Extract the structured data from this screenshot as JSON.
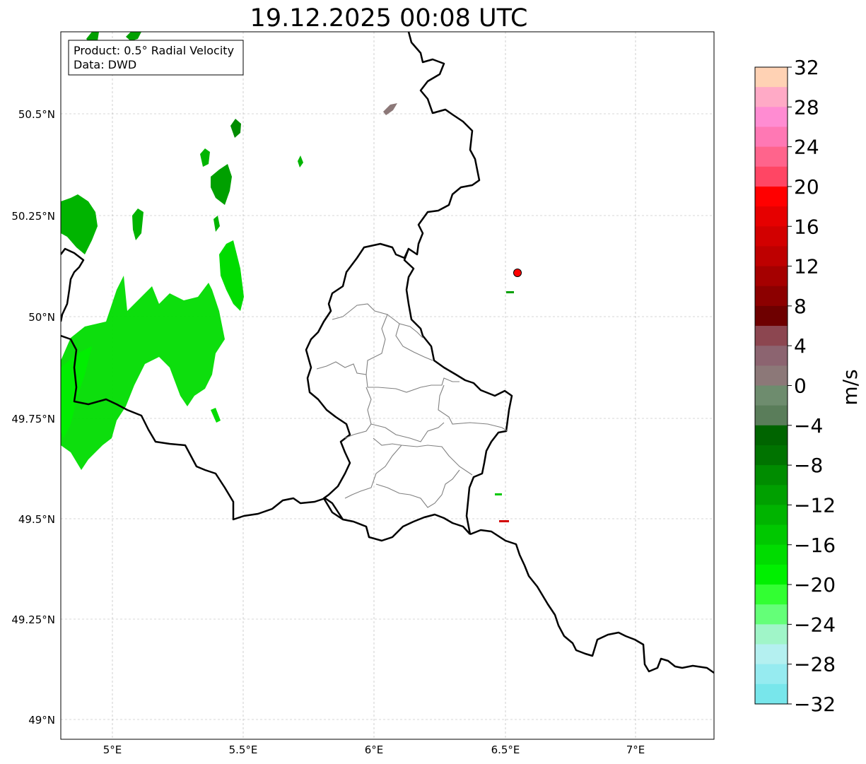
{
  "title": "19.12.2025 00:08 UTC",
  "info_box": {
    "product_line": "Product: 0.5° Radial Velocity",
    "data_line": "Data: DWD"
  },
  "axes": {
    "lon_ticks": [
      "5°E",
      "5.5°E",
      "6°E",
      "6.5°E",
      "7°E"
    ],
    "lat_ticks": [
      "50.5°N",
      "50.25°N",
      "50°N",
      "49.75°N",
      "49.5°N",
      "49.25°N",
      "49°N"
    ]
  },
  "colorbar": {
    "unit": "m/s",
    "tick_labels": [
      "32",
      "28",
      "24",
      "20",
      "16",
      "12",
      "8",
      "4",
      "0",
      "−4",
      "−8",
      "−12",
      "−16",
      "−20",
      "−24",
      "−28",
      "−32"
    ],
    "colors_top_to_bottom": [
      "#ffd2b4",
      "#ffaac6",
      "#ff8cd2",
      "#ff78b4",
      "#ff648c",
      "#ff4664",
      "#ff0000",
      "#e60000",
      "#d20000",
      "#be0000",
      "#a50000",
      "#8c0000",
      "#6e0000",
      "#8c4650",
      "#8c6470",
      "#8c7878",
      "#6e8c6e",
      "#5a7d5a",
      "#006400",
      "#007300",
      "#008c00",
      "#00a000",
      "#00b400",
      "#00c800",
      "#00dc00",
      "#00f000",
      "#32ff32",
      "#64ff78",
      "#a0f5c8",
      "#b4f0f0",
      "#96ebf0",
      "#78e6eb"
    ]
  },
  "radar_marker": {
    "color": "#ff0000"
  }
}
